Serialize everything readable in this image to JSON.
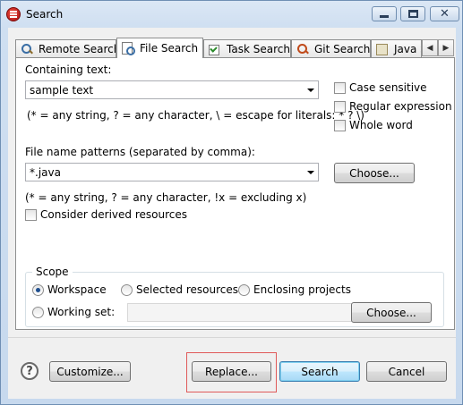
{
  "window": {
    "title": "Search"
  },
  "tabs": [
    {
      "label": "Remote Search",
      "icon": "search-icon",
      "active": false
    },
    {
      "label": "File Search",
      "icon": "file-search-icon",
      "active": true
    },
    {
      "label": "Task Search",
      "icon": "task-search-icon",
      "active": false
    },
    {
      "label": "Git Search",
      "icon": "git-search-icon",
      "active": false
    },
    {
      "label": "Java S",
      "icon": "java-search-icon",
      "active": false
    }
  ],
  "file_search": {
    "containing_text_label": "Containing text:",
    "containing_text_value": "sample text",
    "containing_text_hint": "(* = any string, ? = any character, \\ = escape for literals: * ? \\)",
    "case_sensitive_label": "Case sensitive",
    "case_sensitive_checked": false,
    "regex_label": "Regular expression",
    "regex_checked": false,
    "whole_word_label": "Whole word",
    "whole_word_checked": false,
    "patterns_label": "File name patterns (separated by comma):",
    "patterns_value": "*.java",
    "patterns_hint": "(* = any string, ? = any character, !x = excluding x)",
    "choose_label": "Choose...",
    "derived_label": "Consider derived resources",
    "derived_checked": false
  },
  "scope": {
    "title": "Scope",
    "workspace_label": "Workspace",
    "selected_label": "Selected resources",
    "enclosing_label": "Enclosing projects",
    "working_set_label": "Working set:",
    "working_set_value": "",
    "choose_label": "Choose...",
    "selected": "Workspace"
  },
  "footer": {
    "help_icon": "?",
    "customize_label": "Customize...",
    "replace_label": "Replace...",
    "search_label": "Search",
    "cancel_label": "Cancel"
  }
}
